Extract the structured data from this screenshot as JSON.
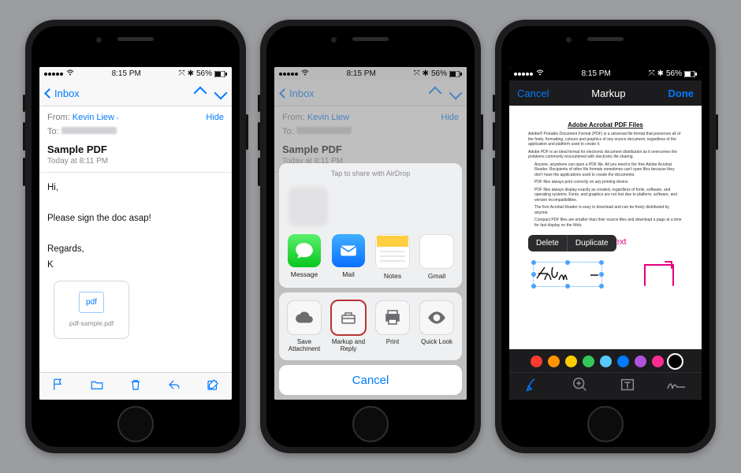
{
  "status": {
    "time": "8:15 PM",
    "carrier": "●●●●●",
    "battery": "56%",
    "wifi": "wifi",
    "nav": "nav",
    "bt": "bt"
  },
  "p1": {
    "back": "Inbox",
    "hdr": {
      "from_label": "From:",
      "from_name": "Kevin Liew",
      "to_label": "To:",
      "hide": "Hide"
    },
    "subject": "Sample PDF",
    "timestamp": "Today at 8:11 PM",
    "body": {
      "line1": "Hi,",
      "line2": "Please sign the doc asap!",
      "line3": "Regards,",
      "line4": "K"
    },
    "attach": {
      "kind": "pdf",
      "name": "pdf-sample.pdf"
    },
    "tblabels": {
      "flag": "flag",
      "folder": "folder",
      "trash": "trash",
      "reply": "reply",
      "compose": "compose"
    }
  },
  "p2": {
    "airdrop_cap": "Tap to share with AirDrop",
    "apps": {
      "message": "Message",
      "mail": "Mail",
      "notes": "Notes",
      "gmail": "Gmail"
    },
    "acts": {
      "save": "Save Attachment",
      "markup": "Markup and Reply",
      "print": "Print",
      "ql": "Quick Look"
    },
    "cancel": "Cancel"
  },
  "p3": {
    "cancel": "Cancel",
    "title": "Markup",
    "done": "Done",
    "doc": {
      "title": "Adobe Acrobat PDF Files",
      "p1": "Adobe® Portable Document Format (PDF) is a universal file format that preserves all of the fonts, formatting, colours and graphics of any source document, regardless of the application and platform used to create it.",
      "p2": "Adobe PDF is an ideal format for electronic document distribution as it overcomes the problems commonly encountered with electronic file sharing.",
      "b1": "Anyone, anywhere can open a PDF file. All you need is the free Adobe Acrobat Reader. Recipients of other file formats sometimes can't open files because they don't have the applications used to create the documents.",
      "b2": "PDF files always print correctly on any printing device.",
      "b3": "PDF files always display exactly as created, regardless of fonts, software, and operating systems. Fonts, and graphics are not lost due to platform, software, and version incompatibilities.",
      "b4": "The free Acrobat Reader is easy to download and can be freely distributed by anyone.",
      "b5": "Compact PDF files are smaller than their source files and download a page at a time for fast display on the Web."
    },
    "typing": "Typing text",
    "menu": {
      "delete": "Delete",
      "duplicate": "Duplicate"
    },
    "colors": [
      "#ff3b30",
      "#ff9500",
      "#ffcc00",
      "#34c759",
      "#5ac8fa",
      "#007aff",
      "#af52de",
      "#ff2d92",
      "#000000"
    ],
    "selected_color": 8,
    "tools": {
      "pen": "pen",
      "zoom": "zoom",
      "text": "text",
      "sign": "sign"
    }
  }
}
